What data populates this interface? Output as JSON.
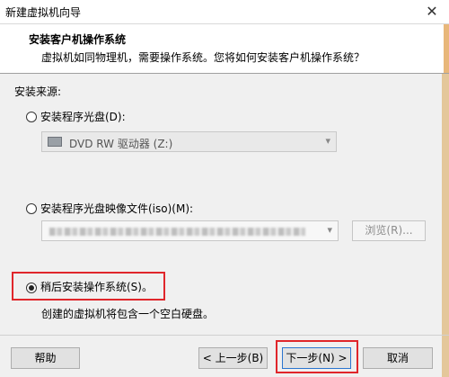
{
  "window": {
    "title": "新建虚拟机向导",
    "close_icon": "close-icon"
  },
  "header": {
    "title": "安装客户机操作系统",
    "description": "虚拟机如同物理机，需要操作系统。您将如何安装客户机操作系统？"
  },
  "install_source": {
    "label": "安装来源:",
    "options": [
      {
        "label": "安装程序光盘(D):",
        "checked": false
      },
      {
        "label": "安装程序光盘映像文件(iso)(M):",
        "checked": false
      },
      {
        "label": "稍后安装操作系统(S)。",
        "checked": true
      }
    ],
    "drive_select": {
      "value": "DVD RW 驱动器 (Z:)",
      "icon": "dvd-drive-icon",
      "enabled": false
    },
    "iso_path": {
      "value": "",
      "blurred": true
    },
    "browse_label": "浏览(R)...",
    "later_description": "创建的虚拟机将包含一个空白硬盘。"
  },
  "footer": {
    "help_label": "帮助",
    "back_label": "< 上一步(B)",
    "next_label": "下一步(N) >",
    "cancel_label": "取消"
  },
  "colors": {
    "highlight_frame": "#e0262b",
    "focus_border": "#2a75cf"
  }
}
